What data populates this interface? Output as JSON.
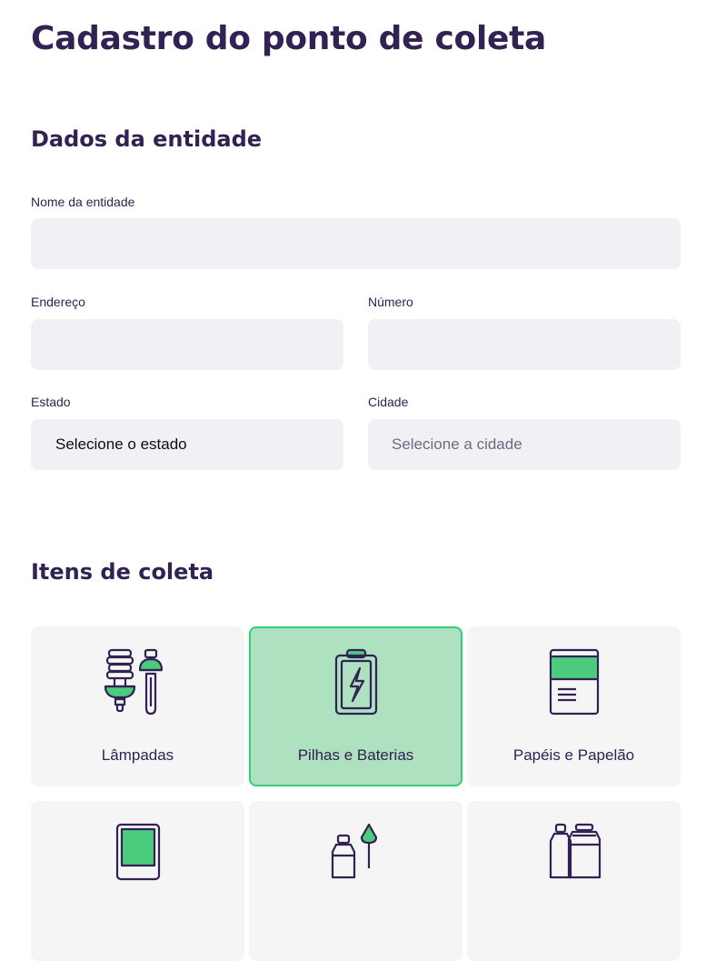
{
  "page": {
    "title": "Cadastro do ponto de coleta"
  },
  "entity_section": {
    "title": "Dados da entidade",
    "name_label": "Nome da entidade",
    "name_value": "",
    "address_label": "Endereço",
    "address_value": "",
    "number_label": "Número",
    "number_value": "",
    "state_label": "Estado",
    "state_value": "Selecione o estado",
    "city_label": "Cidade",
    "city_value": "Selecione a cidade"
  },
  "items_section": {
    "title": "Itens de coleta",
    "items": [
      {
        "label": "Lâmpadas",
        "icon": "lamp-icon",
        "selected": false
      },
      {
        "label": "Pilhas e Baterias",
        "icon": "battery-icon",
        "selected": true
      },
      {
        "label": "Papéis e Papelão",
        "icon": "paper-icon",
        "selected": false
      },
      {
        "label": "",
        "icon": "electronics-icon",
        "selected": false
      },
      {
        "label": "",
        "icon": "organic-icon",
        "selected": false
      },
      {
        "label": "",
        "icon": "oil-icon",
        "selected": false
      }
    ]
  },
  "colors": {
    "title": "#322153",
    "field_bg": "#f0f0f5",
    "item_bg": "#f5f5f5",
    "selected_bg": "#ade1bf",
    "selected_border": "#34cb79",
    "accent_green": "#4acb7e"
  }
}
